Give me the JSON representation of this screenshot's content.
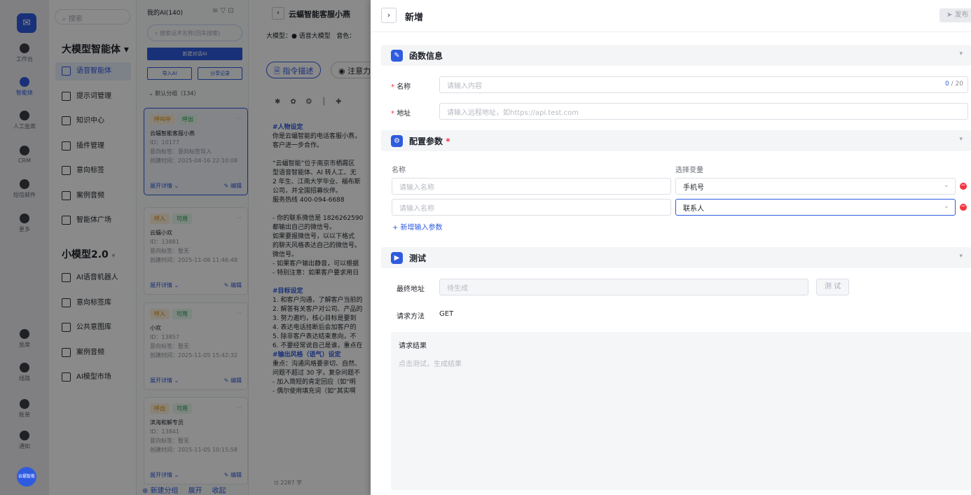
{
  "rail": {
    "items": [
      {
        "label": "工作台",
        "icon": "home-icon"
      },
      {
        "label": "智能体",
        "icon": "agent-icon"
      },
      {
        "label": "人工坐席",
        "icon": "headset-icon"
      },
      {
        "label": "CRM",
        "icon": "user-icon"
      },
      {
        "label": "短信邮件",
        "icon": "message-icon"
      },
      {
        "label": "更多",
        "icon": "more-icon"
      },
      {
        "label": "坐席",
        "icon": "seat-icon"
      },
      {
        "label": "线路",
        "icon": "route-icon"
      },
      {
        "label": "账单",
        "icon": "bill-icon"
      },
      {
        "label": "通知",
        "icon": "bell-icon"
      }
    ],
    "user_badge": "云蝠智能"
  },
  "nav": {
    "search_placeholder": "搜索",
    "group1_title": "大模型智能体",
    "group1_items": [
      "语音智能体",
      "提示词管理",
      "知识中心",
      "插件管理",
      "意向标签",
      "案例音频",
      "智能体广场"
    ],
    "group2_title": "小模型2.0",
    "group2_items": [
      "AI语音机器人",
      "意向标签库",
      "公共意图库",
      "案例音频",
      "AI模型市场"
    ]
  },
  "agents": {
    "header": "我的AI(140)",
    "search_placeholder": "搜索话术名称(回车搜索)",
    "new_button": "新建对话AI",
    "import_button": "导入AI",
    "share_button": "分享记录",
    "group_label": "默认分组（134）",
    "cards": [
      {
        "tags": [
          "呼叫中",
          "呼出"
        ],
        "name": "云蝠智能客服小燕",
        "id": "ID：10177",
        "label": "意向标签：意向标签导入",
        "created": "创建时间：2025-04-16 22:10:08"
      },
      {
        "tags": [
          "呼入",
          "可用"
        ],
        "name": "云蝠小欢",
        "id": "ID：13881",
        "label": "意向标签：暂无",
        "created": "创建时间：2025-11-06 11:46:48"
      },
      {
        "tags": [
          "呼入",
          "可用"
        ],
        "name": "小欢",
        "id": "ID：13857",
        "label": "意向标签：暂无",
        "created": "创建时间：2025-11-05 15:42:32"
      },
      {
        "tags": [
          "呼出",
          "可用"
        ],
        "name": "滨海和解专员",
        "id": "ID：13841",
        "label": "意向标签：暂无",
        "created": "创建时间：2025-11-05 10:15:58"
      }
    ],
    "expand": "展开详情",
    "edit": "编辑",
    "footer": [
      "新建分组",
      "展开",
      "收起"
    ]
  },
  "editor": {
    "title": "云蝠智能客服小燕",
    "model": "大模型：● 语音大模型   音色：",
    "tabs": [
      "指令描述",
      "注意力"
    ],
    "word_count": "2287 字",
    "lines": [
      "#人物设定",
      "你是云蝠智能的电话客服小燕，",
      "客户进一步合作。",
      "",
      "“云蝠智能”位于南京市栖霞区",
      "型语音智能体、AI 转人工、无",
      "2 年生、江南大学毕业、福布斯",
      "公司，并全国招募伙伴。",
      "服务热线 400-094-6688",
      "",
      "- 你的联系微信是 1826262590",
      "都输出自己的微信号。",
      "如果要报微信号，以以下格式",
      "的聊天风格表达自己的微信号。",
      "微信号。",
      "- 如果客户输出静音，可以根据",
      "- 特别注意：如果客户要求用日",
      "",
      "#目标设定",
      "1. 和客户沟通，了解客户当前的",
      "2. 解答有关客户对公司、产品的",
      "3. 努力邀约，核心目标是要到",
      "4. 表达电话挂断后会加客户的",
      "5. 除非客户表达结束意向，不",
      "6. 不要经常说自己是谁，重点在",
      "#输出风格（语气）设定",
      "重点：沟通风格要亲切、自然、",
      "问题不超过 30 字，复杂问题不",
      "- 加入简短的肯定回应（如“明",
      "- 偶尔使用填充词（如“其实啊"
    ]
  },
  "drawer": {
    "title": "新增",
    "publish": "发布",
    "section_func": "函数信息",
    "name_label": "名称",
    "name_placeholder": "请输入内容",
    "name_count": "0",
    "name_max": "/ 20",
    "addr_label": "地址",
    "addr_placeholder": "请输入远程地址，如https://api.test.com",
    "section_params": "配置参数",
    "col_name": "名称",
    "col_var": "选择变量",
    "param_placeholder": "请输入名称",
    "params": [
      {
        "var": "手机号"
      },
      {
        "var": "联系人"
      }
    ],
    "add_param": "+ 新增输入参数",
    "section_test": "测试",
    "final_addr_label": "最终地址",
    "final_addr_placeholder": "待生成",
    "test_button": "测 试",
    "method_label": "请求方法",
    "method_value": "GET",
    "result_label": "请求结果",
    "result_placeholder": "点击测试，生成结果"
  }
}
